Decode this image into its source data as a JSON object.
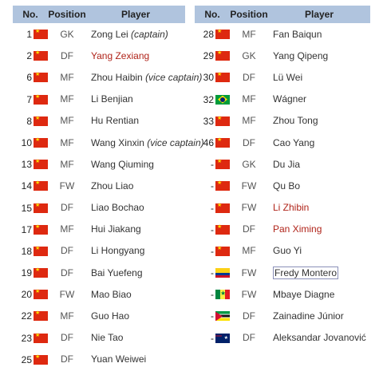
{
  "headers": {
    "no": "No.",
    "position": "Position",
    "player": "Player"
  },
  "left_rows": [
    {
      "no": "1",
      "flag": "cn-flag",
      "pos": "GK",
      "name": "Zong Lei",
      "role": "(captain)"
    },
    {
      "no": "2",
      "flag": "cn-flag",
      "pos": "DF",
      "name": "Yang Zexiang",
      "style": "red"
    },
    {
      "no": "6",
      "flag": "cn-flag",
      "pos": "MF",
      "name": "Zhou Haibin",
      "role": "(vice captain)"
    },
    {
      "no": "7",
      "flag": "cn-flag",
      "pos": "MF",
      "name": "Li Benjian"
    },
    {
      "no": "8",
      "flag": "cn-flag",
      "pos": "MF",
      "name": "Hu Rentian"
    },
    {
      "no": "10",
      "flag": "cn-flag",
      "pos": "MF",
      "name": "Wang Xinxin",
      "role": "(vice captain)"
    },
    {
      "no": "13",
      "flag": "cn-flag",
      "pos": "MF",
      "name": "Wang Qiuming"
    },
    {
      "no": "14",
      "flag": "cn-flag",
      "pos": "FW",
      "name": "Zhou Liao"
    },
    {
      "no": "15",
      "flag": "cn-flag",
      "pos": "DF",
      "name": "Liao Bochao"
    },
    {
      "no": "17",
      "flag": "cn-flag",
      "pos": "MF",
      "name": "Hui Jiakang"
    },
    {
      "no": "18",
      "flag": "cn-flag",
      "pos": "DF",
      "name": "Li Hongyang"
    },
    {
      "no": "19",
      "flag": "cn-flag",
      "pos": "DF",
      "name": "Bai Yuefeng"
    },
    {
      "no": "20",
      "flag": "cn-flag",
      "pos": "FW",
      "name": "Mao Biao"
    },
    {
      "no": "22",
      "flag": "cn-flag",
      "pos": "MF",
      "name": "Guo Hao"
    },
    {
      "no": "23",
      "flag": "cn-flag",
      "pos": "DF",
      "name": "Nie Tao"
    },
    {
      "no": "25",
      "flag": "cn-flag",
      "pos": "DF",
      "name": "Yuan Weiwei"
    }
  ],
  "right_rows": [
    {
      "no": "28",
      "flag": "cn-flag",
      "pos": "MF",
      "name": "Fan Baiqun"
    },
    {
      "no": "29",
      "flag": "cn-flag",
      "pos": "GK",
      "name": "Yang Qipeng"
    },
    {
      "no": "30",
      "flag": "cn-flag",
      "pos": "DF",
      "name": "Lü Wei"
    },
    {
      "no": "32",
      "flag": "br-flag",
      "pos": "MF",
      "name": "Wágner"
    },
    {
      "no": "33",
      "flag": "cn-flag",
      "pos": "MF",
      "name": "Zhou Tong"
    },
    {
      "no": "46",
      "flag": "cn-flag",
      "pos": "DF",
      "name": "Cao Yang"
    },
    {
      "no": "-",
      "flag": "cn-flag",
      "pos": "GK",
      "name": "Du Jia"
    },
    {
      "no": "-",
      "flag": "cn-flag",
      "pos": "FW",
      "name": "Qu Bo"
    },
    {
      "no": "-",
      "flag": "cn-flag",
      "pos": "FW",
      "name": "Li Zhibin",
      "style": "red"
    },
    {
      "no": "-",
      "flag": "cn-flag",
      "pos": "DF",
      "name": "Pan Ximing",
      "style": "red"
    },
    {
      "no": "-",
      "flag": "cn-flag",
      "pos": "MF",
      "name": "Guo Yi"
    },
    {
      "no": "-",
      "flag": "co-flag",
      "pos": "FW",
      "name": "Fredy Montero",
      "style": "boxed"
    },
    {
      "no": "-",
      "flag": "sn-flag",
      "pos": "FW",
      "name": "Mbaye Diagne"
    },
    {
      "no": "-",
      "flag": "mz-flag",
      "pos": "DF",
      "name": "Zainadine Júnior"
    },
    {
      "no": "-",
      "flag": "au-flag",
      "pos": "DF",
      "name": "Aleksandar Jovanović"
    }
  ],
  "colors": {
    "header_bg": "#b0c4de",
    "red_link": "#b0241a",
    "china_red": "#de2910"
  }
}
